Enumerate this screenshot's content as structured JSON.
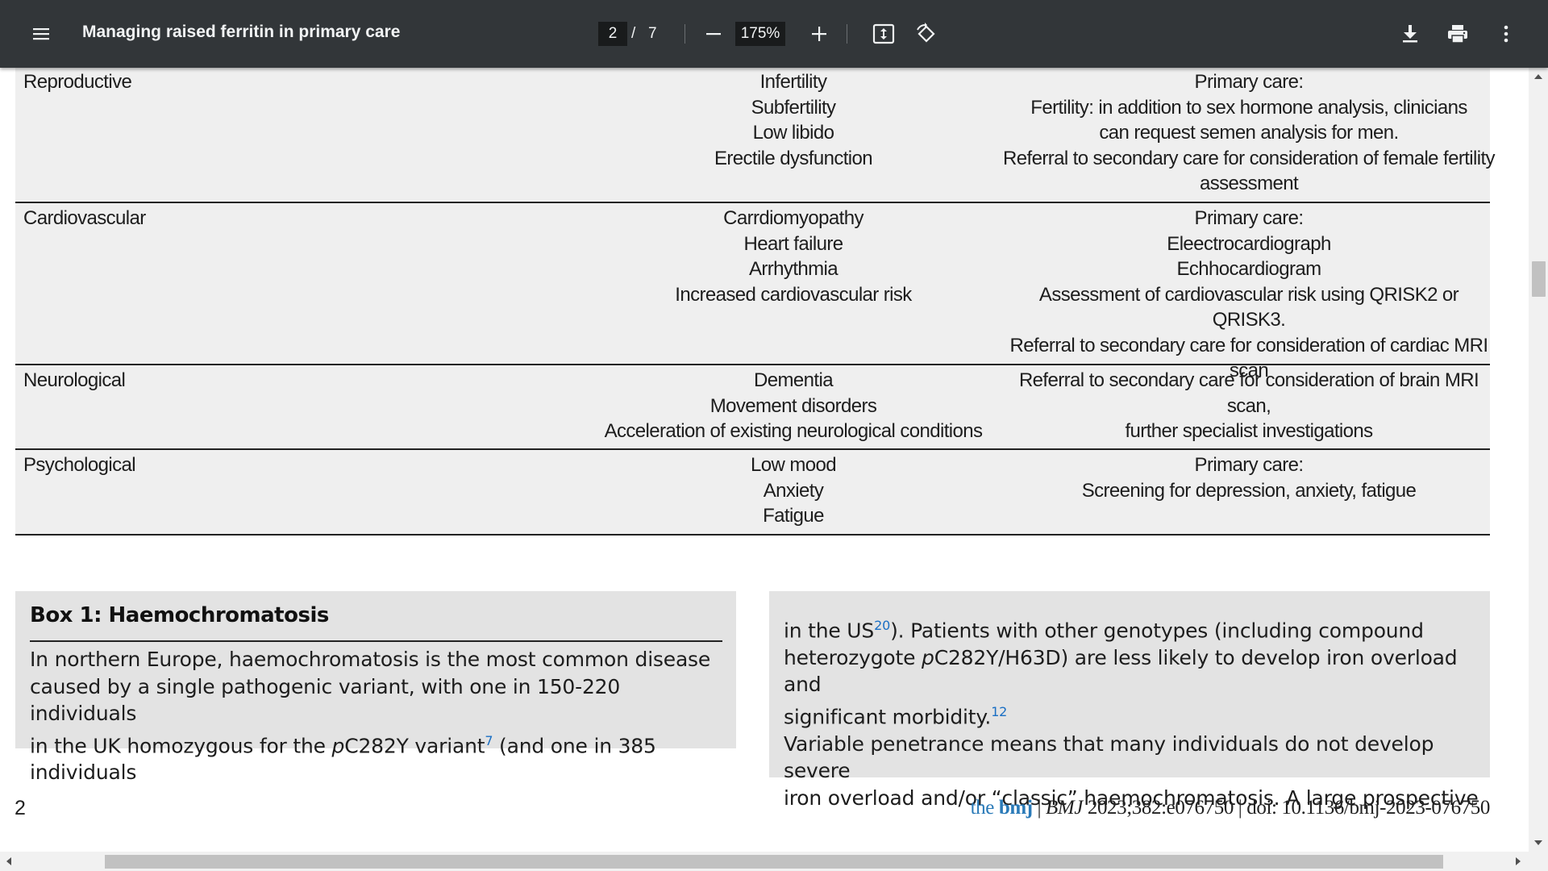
{
  "toolbar": {
    "title": "Managing raised ferritin in primary care",
    "page_current": "2",
    "page_separator": "/",
    "page_total": "7",
    "zoom": "175%",
    "icons": {
      "menu": "menu-icon",
      "zoom_out": "minus-icon",
      "zoom_in": "plus-icon",
      "fit": "fit-page-icon",
      "rotate": "rotate-icon",
      "download": "download-icon",
      "print": "print-icon",
      "more": "more-vert-icon"
    }
  },
  "table": {
    "rows": [
      {
        "system": "Reproductive",
        "conditions": [
          "Infertility",
          "Subfertility",
          "Low libido",
          "Erectile dysfunction"
        ],
        "management": [
          "Primary care:",
          "Fertility: in addition to sex hormone analysis, clinicians",
          "can request semen analysis for men.",
          "Referral to secondary care for consideration of female fertility",
          "assessment"
        ]
      },
      {
        "system": "Cardiovascular",
        "conditions": [
          "Carrdiomyopathy",
          "Heart failure",
          "Arrhythmia",
          "Increased cardiovascular risk"
        ],
        "management": [
          "Primary care:",
          "Eleectrocardiograph",
          "Echhocardiogram",
          "Assessment of cardiovascular risk using QRISK2 or",
          "QRISK3.",
          "Referral to secondary care for consideration of cardiac MRI scan"
        ]
      },
      {
        "system": "Neurological",
        "conditions": [
          "Dementia",
          "Movement disorders",
          "Acceleration of existing neurological conditions"
        ],
        "management": [
          "Referral to secondary care for consideration of brain MRI scan,",
          "further specialist investigations"
        ]
      },
      {
        "system": "Psychological",
        "conditions": [
          "Low mood",
          "Anxiety",
          "Fatigue"
        ],
        "management": [
          "Primary care:",
          "Screening for depression, anxiety, fatigue"
        ]
      }
    ]
  },
  "box1": {
    "heading": "Box 1: Haemochromatosis",
    "line1": "In northern Europe, haemochromatosis is the most common disease",
    "line2": "caused by a single pathogenic variant, with one in 150-220 individuals",
    "line3_a": "in the UK homozygous for the ",
    "line3_variant_prefix": "p",
    "line3_variant": "C282Y variant",
    "line3_ref": "7",
    "line3_b": " (and one in 385 individuals"
  },
  "box1_cont": {
    "line1_a": "in the US",
    "line1_ref": "20",
    "line1_b": "). Patients with other genotypes (including compound",
    "line2_a": "heterozygote ",
    "line2_variant_prefix": "p",
    "line2_b": "C282Y/H63D) are less likely to develop iron overload and",
    "line3_a": "significant morbidity.",
    "line3_ref": "12",
    "line4": "Variable penetrance means that many individuals do not develop severe",
    "line5": "iron overload and/or “classic” haemochromatosis. A large prospective"
  },
  "footer": {
    "page_number": "2",
    "brand_the": "the",
    "brand_bmj": "bmj",
    "separator": " | ",
    "journal": "BMJ",
    "citation": " 2023;382:e076750 | doi: 10.1136/bmj-2023-076750"
  },
  "scroll": {
    "vertical_position": 0.26,
    "horizontal_position": 0.07
  },
  "colors": {
    "toolbar_bg": "#323639",
    "table_bg": "#efefef",
    "box_bg": "#e3e3e3",
    "link": "#1a6fc4",
    "brand": "#2a7ab8"
  }
}
